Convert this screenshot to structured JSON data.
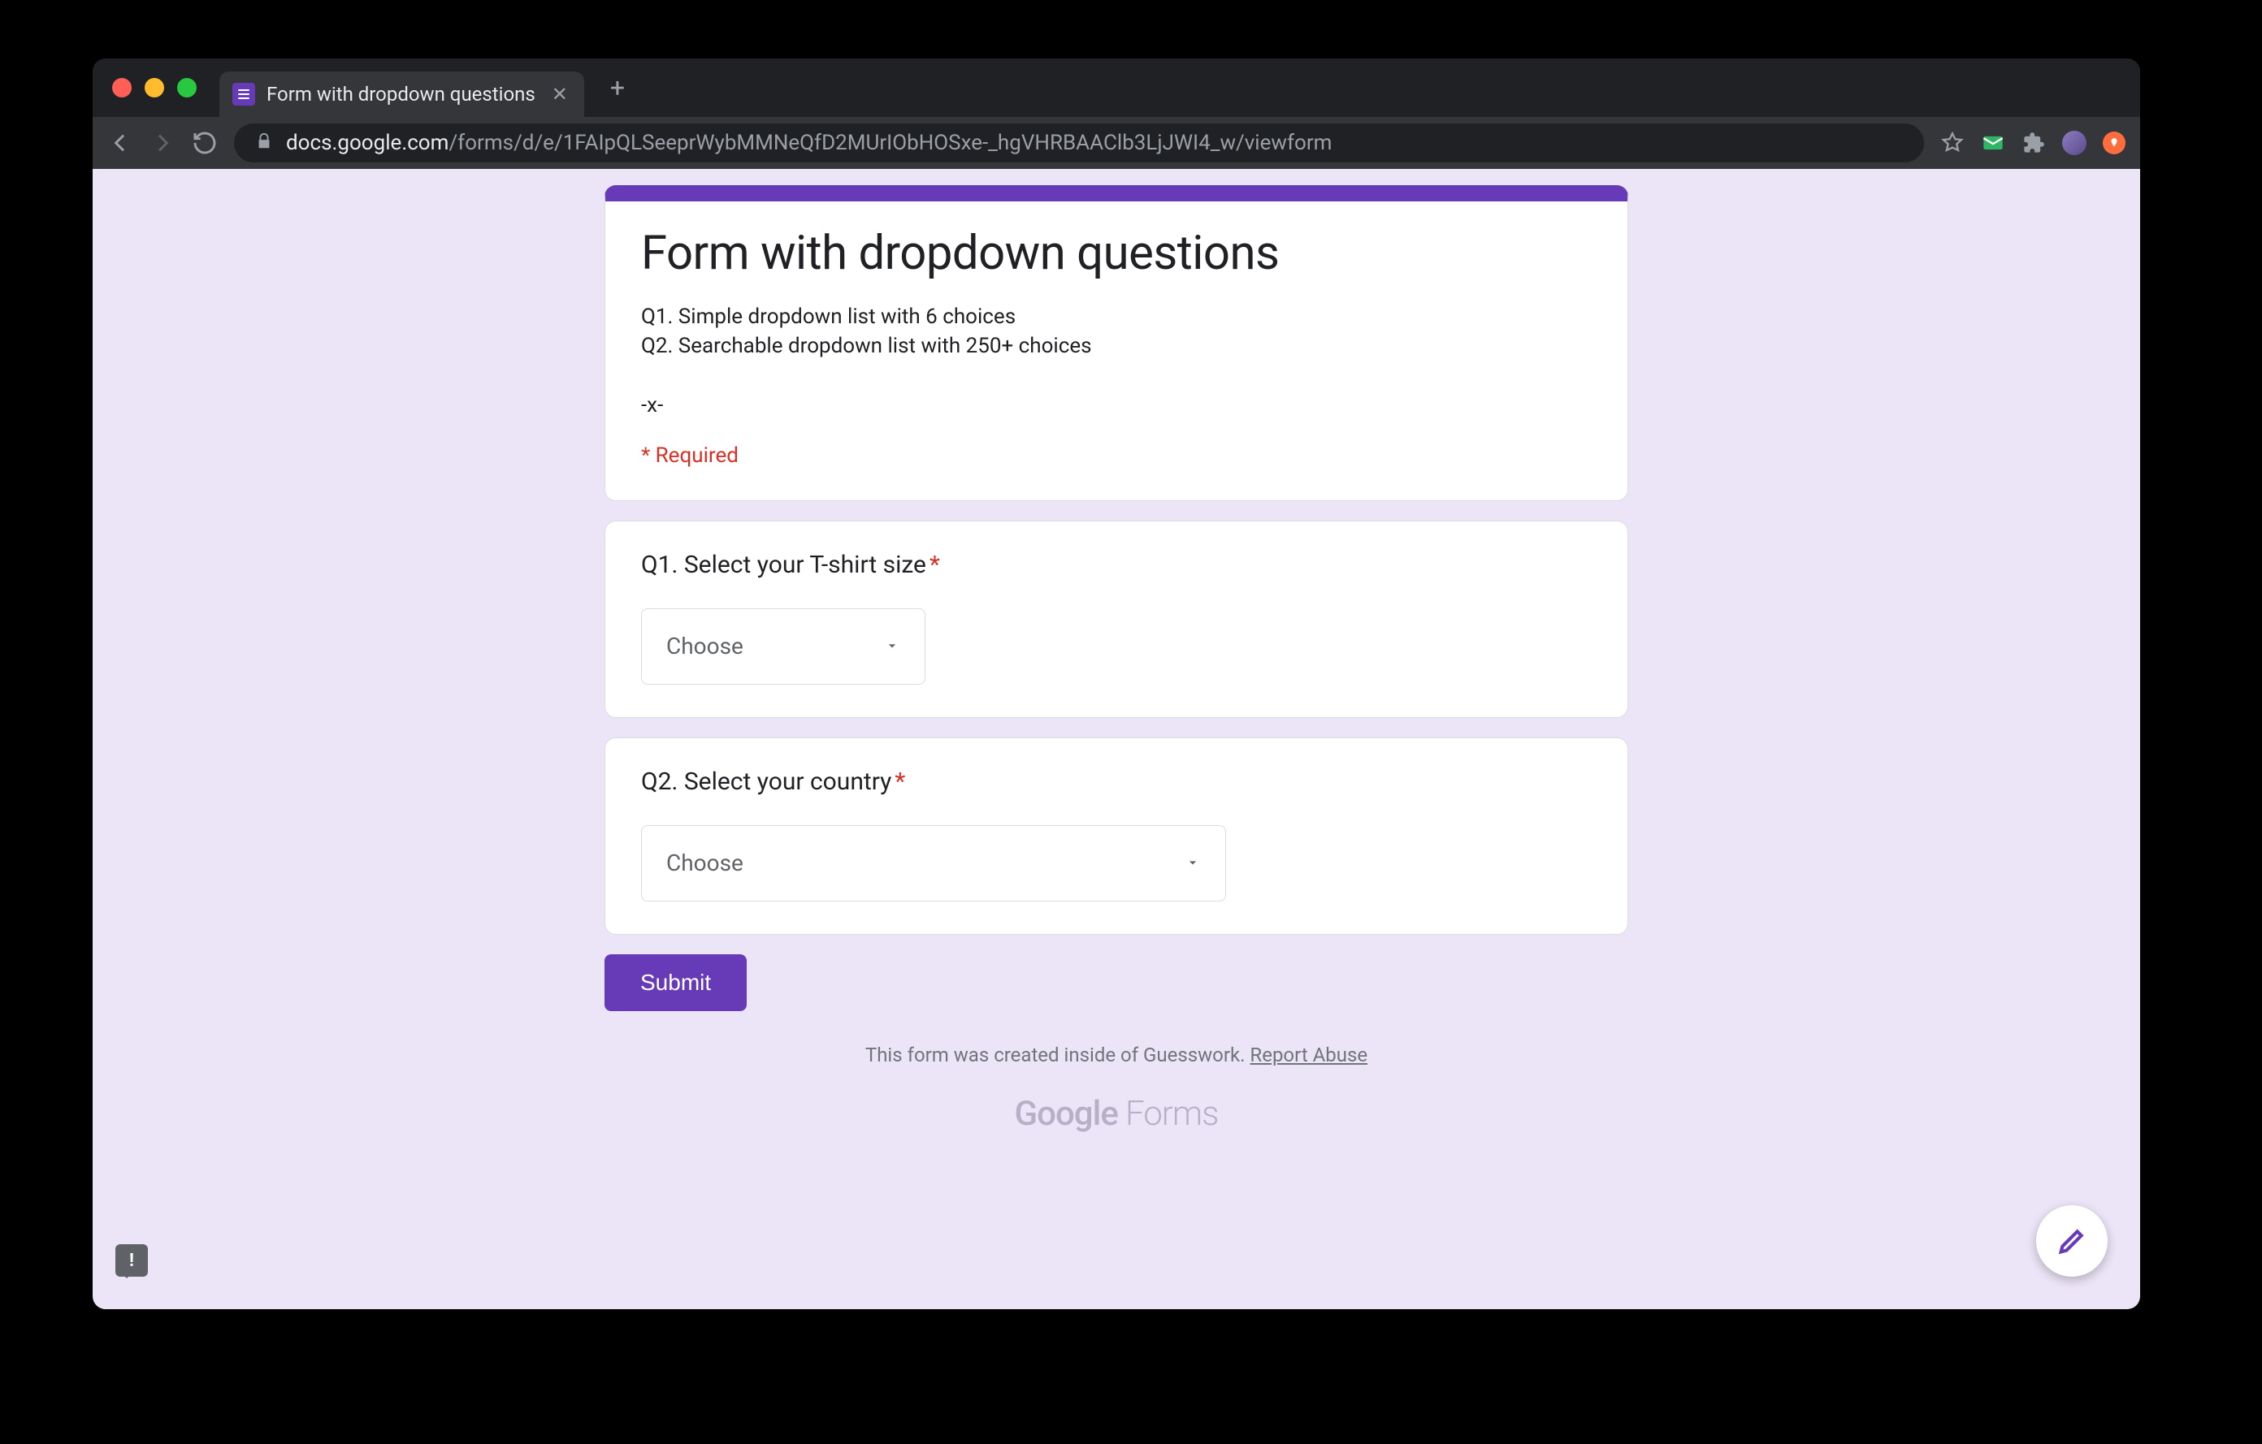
{
  "browser": {
    "tab_title": "Form with dropdown questions",
    "url_host": "docs.google.com",
    "url_path": "/forms/d/e/1FAIpQLSeeprWybMMNeQfD2MUrIObHOSxe-_hgVHRBAAClb3LjJWI4_w/viewform"
  },
  "form": {
    "title": "Form with dropdown questions",
    "description": "Q1. Simple dropdown list with 6 choices\nQ2. Searchable dropdown list with 250+ choices\n\n-x-",
    "required_label": "* Required",
    "questions": [
      {
        "label": "Q1. Select your T-shirt size",
        "required": true,
        "dropdown_value": "Choose"
      },
      {
        "label": "Q2. Select your country",
        "required": true,
        "dropdown_value": "Choose"
      }
    ],
    "submit_label": "Submit"
  },
  "footer": {
    "text_prefix": "This form was created inside of Guesswork. ",
    "report_link": "Report Abuse",
    "logo_google": "Google",
    "logo_forms": " Forms"
  },
  "asterisk_char": "*"
}
